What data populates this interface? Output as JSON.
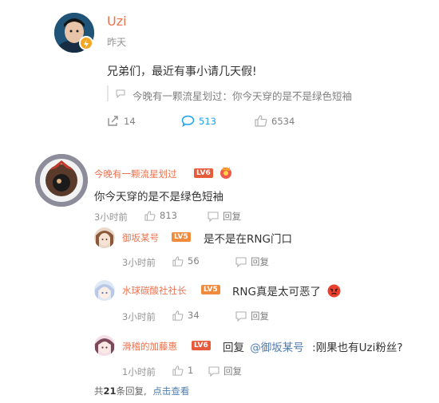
{
  "post": {
    "author": "Uzi",
    "time": "昨天",
    "text": "兄弟们，最近有事小请几天假!",
    "quote": "今晚有一颗流星划过：你今天穿的是不是绿色短袖",
    "reposts": "14",
    "comments": "513",
    "likes": "6534"
  },
  "comment": {
    "author": "今晚有一颗流星划过",
    "level": "LV6",
    "text": "你今天穿的是不是绿色短袖",
    "time": "3小时前",
    "likes": "813",
    "reply_label": "回复"
  },
  "replies": [
    {
      "author": "御坂某号",
      "level": "LV5",
      "text": "是不是在RNG门口",
      "time": "3小时前",
      "likes": "56",
      "reply_label": "回复"
    },
    {
      "author": "水球碳酸社社长",
      "level": "LV5",
      "text": "RNG真是太可恶了",
      "time": "3小时前",
      "likes": "34",
      "reply_label": "回复"
    },
    {
      "author": "滑稽的加藤惠",
      "level": "LV6",
      "prefix": "回复",
      "mention": "@御坂某号",
      "text": ":刚果也有Uzi粉丝?",
      "time": "1小时前",
      "likes": "1",
      "reply_label": "回复"
    }
  ],
  "summary": {
    "count_prefix": "共",
    "count": "21",
    "count_suffix": "条回复,",
    "link": "点击查看"
  },
  "colors": {
    "name_pink": "#eb7350",
    "link_blue": "#507daf",
    "lv6": "#e55b3b",
    "lv5": "#f08a3c",
    "comment_blue": "#1da1f2"
  }
}
